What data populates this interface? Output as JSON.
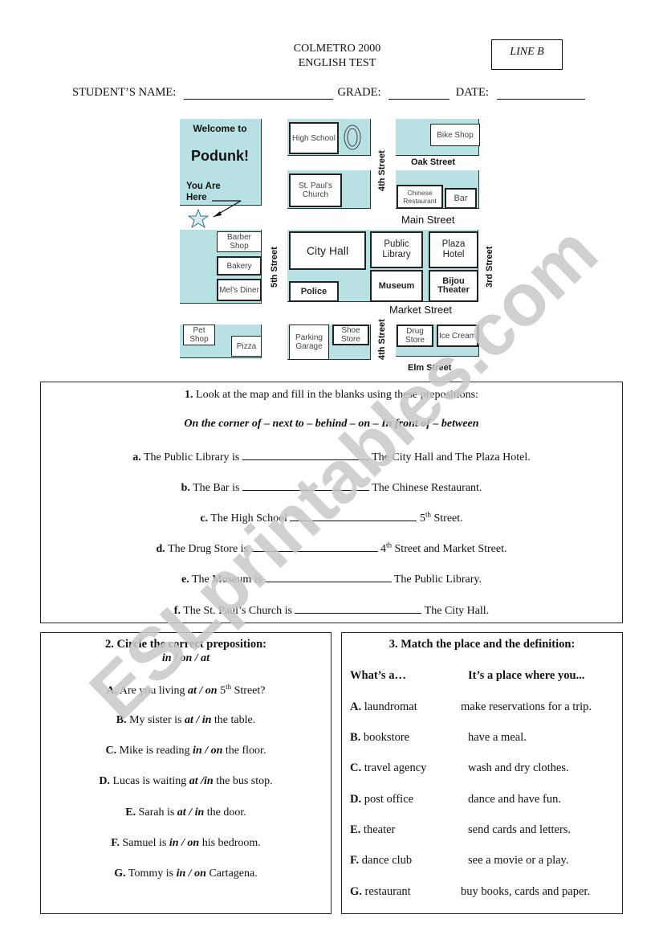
{
  "header": {
    "school": "COLMETRO 2000",
    "test": "ENGLISH TEST",
    "line_label": "LINE B",
    "student_name_label": "STUDENT’S NAME:",
    "grade_label": "GRADE:",
    "date_label": "DATE:"
  },
  "map": {
    "welcome": "Welcome to",
    "town": "Podunk!",
    "you_are_here": "You Are Here",
    "streets": {
      "oak": "Oak Street",
      "main": "Main Street",
      "market": "Market Street",
      "elm": "Elm Street",
      "fourth_top": "4th Street",
      "fourth_bottom": "4th Street",
      "fifth": "5th Street",
      "third": "3rd Street"
    },
    "buildings": {
      "high_school": "High School",
      "bike_shop": "Bike Shop",
      "st_pauls": "St. Paul’s Church",
      "chinese_restaurant": "Chinese Restaurant",
      "bar": "Bar",
      "barber_shop": "Barber Shop",
      "bakery": "Bakery",
      "mels_diner": "Mel’s Diner",
      "city_hall": "City Hall",
      "public_library": "Public Library",
      "plaza_hotel": "Plaza Hotel",
      "police": "Police",
      "museum": "Museum",
      "bijou_theater": "Bijou Theater",
      "pet_shop": "Pet Shop",
      "pizza": "Pizza",
      "parking_garage": "Parking Garage",
      "shoe_store": "Shoe Store",
      "drug_store": "Drug Store",
      "ice_cream": "Ice Cream"
    }
  },
  "section1": {
    "number": "1.",
    "instruction": "Look at the map and fill in the blanks using these prepositions:",
    "prepositions": "On the corner of – next to – behind – on – In front of – between",
    "items": [
      {
        "letter": "a.",
        "before": "The Public Library is",
        "after": "The City Hall and The Plaza Hotel.",
        "sup": ""
      },
      {
        "letter": "b.",
        "before": "The Bar is",
        "after": "The Chinese Restaurant.",
        "sup": ""
      },
      {
        "letter": "c.",
        "before": "The High School",
        "after_num": "5",
        "sup": "th",
        "after": "Street."
      },
      {
        "letter": "d.",
        "before": "The Drug Store is",
        "after_num": "4",
        "sup": "th",
        "after": "Street and Market Street."
      },
      {
        "letter": "e.",
        "before": "The Museum is",
        "after": "The Public Library.",
        "sup": ""
      },
      {
        "letter": "f.",
        "before": "The St. Paul’s Church is",
        "after": "The City Hall.",
        "sup": ""
      }
    ]
  },
  "section2": {
    "title": "2. Circle the correct preposition:",
    "options": "in / on / at",
    "items": [
      {
        "letter": "A.",
        "before": "Are you living",
        "choice": "at / on",
        "after_num": "5",
        "sup": "th",
        "after": "Street?"
      },
      {
        "letter": "B.",
        "before": "My sister is",
        "choice": "at / in",
        "after": "the table."
      },
      {
        "letter": "C.",
        "before": "Mike is reading",
        "choice": "in / on",
        "after": "the floor."
      },
      {
        "letter": "D.",
        "before": "Lucas is waiting",
        "choice": "at /in",
        "after": "the bus stop."
      },
      {
        "letter": "E.",
        "before": "Sarah is",
        "choice": "at / in",
        "after": "the door."
      },
      {
        "letter": "F.",
        "before": "Samuel is",
        "choice": "in / on",
        "after": "his bedroom."
      },
      {
        "letter": "G.",
        "before": "Tommy is",
        "choice": "in / on",
        "after": "Cartagena."
      }
    ]
  },
  "section3": {
    "title": "3. Match the place and the definition:",
    "col1_header": "What’s a…",
    "col2_header": "It’s a place where you...",
    "items": [
      {
        "letter": "A.",
        "place": "laundromat",
        "definition": "make reservations for a trip."
      },
      {
        "letter": "B.",
        "place": "bookstore",
        "definition": "have a meal."
      },
      {
        "letter": "C.",
        "place": "travel agency",
        "definition": "wash and dry clothes."
      },
      {
        "letter": "D.",
        "place": "post office",
        "definition": "dance and have fun."
      },
      {
        "letter": "E.",
        "place": "theater",
        "definition": "send cards and letters."
      },
      {
        "letter": "F.",
        "place": "dance club",
        "definition": "see a movie or a play."
      },
      {
        "letter": "G.",
        "place": "restaurant",
        "definition": "buy books, cards and paper."
      }
    ]
  },
  "watermark": {
    "text": "ESLprintables.com",
    "color": "#c8c8c8"
  },
  "colors": {
    "map_block": "#b7e1e2"
  }
}
